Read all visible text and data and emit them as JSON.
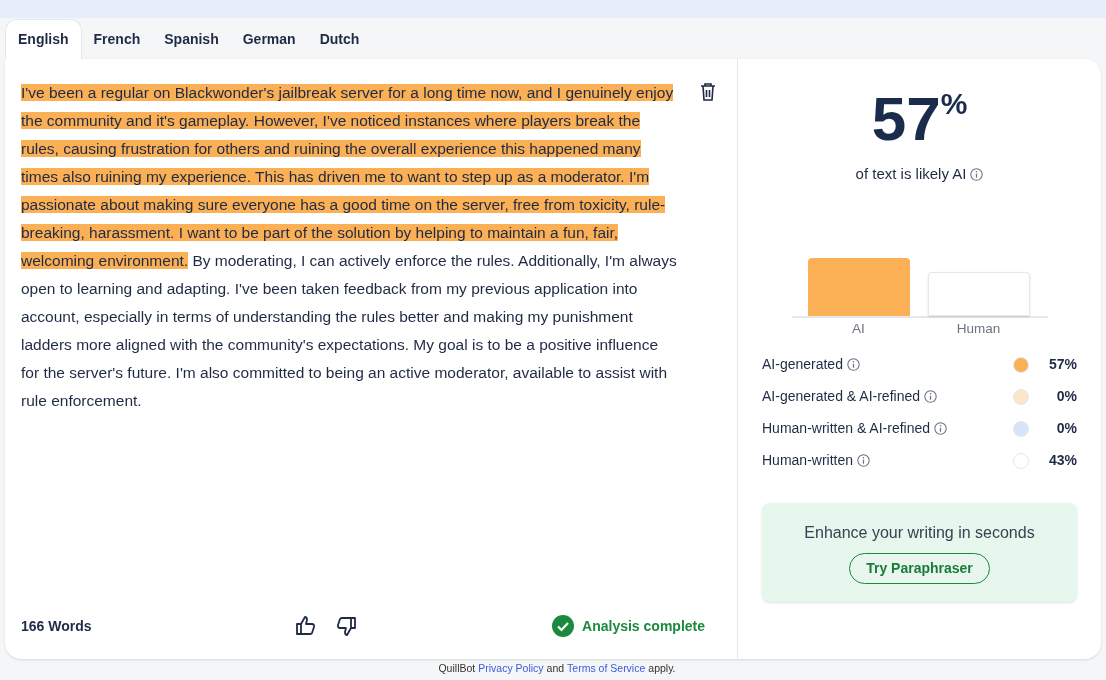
{
  "tabs": [
    {
      "label": "English",
      "selected": true
    },
    {
      "label": "French",
      "selected": false
    },
    {
      "label": "Spanish",
      "selected": false
    },
    {
      "label": "German",
      "selected": false
    },
    {
      "label": "Dutch",
      "selected": false
    }
  ],
  "text_segments": [
    {
      "text": "I've been a regular on Blackwonder's jailbreak server for a long time now, and I genuinely enjoy the community and it's gameplay. However, I've noticed instances where players break the rules, causing frustration for others and ruining the overall experience this happened many times also ruining my experience. This has driven me to want to step up as a moderator. I'm passionate about making sure everyone has a good time on the server, free from toxicity, rule-breaking, harassment. I want to be part of the solution by helping to maintain a fun, fair, welcoming environment.",
      "ai": true
    },
    {
      "text": " By moderating, I can actively enforce the rules. Additionally, I'm always open to learning and adapting. I've been taken feedback from my previous application into account, especially in terms of understanding the rules better and making my punishment ladders more aligned with the community's expectations. My goal is to be a positive influence for the server's future. I'm also committed to being an active moderator, available to assist with rule enforcement.",
      "ai": false
    }
  ],
  "word_count": "166 Words",
  "status": "Analysis complete",
  "score": {
    "value": "57",
    "unit": "%",
    "caption": "of text is likely AI"
  },
  "bar_labels": [
    "AI",
    "Human"
  ],
  "legend": [
    {
      "label": "AI-generated",
      "value": "57%",
      "color": "#fbb055"
    },
    {
      "label": "AI-generated & AI-refined",
      "value": "0%",
      "color": "#fde6c8"
    },
    {
      "label": "Human-written & AI-refined",
      "value": "0%",
      "color": "#d6e4fb"
    },
    {
      "label": "Human-written",
      "value": "43%",
      "color": "#ffffff"
    }
  ],
  "promo": {
    "text": "Enhance your writing in seconds",
    "button": "Try Paraphraser"
  },
  "footer": {
    "brand": "QuillBot",
    "link1": "Privacy Policy",
    "and": "and",
    "link2": "Terms of Service",
    "tail": "apply."
  }
}
